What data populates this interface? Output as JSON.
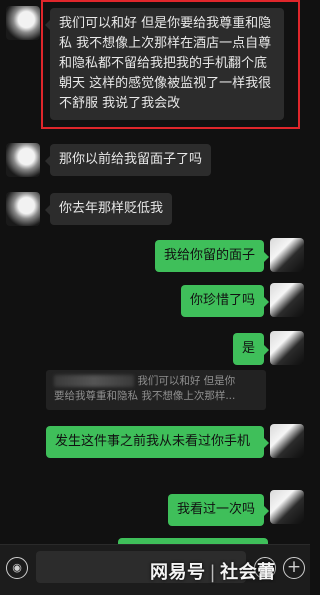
{
  "messages": [
    {
      "side": "them",
      "text": "我们可以和好 但是你要给我尊重和隐私 我不想像上次那样在酒店一点自尊和隐私都不留给我把我的手机翻个底朝天 这样的感觉像被监视了一样我很不舒服 我说了我会改"
    },
    {
      "side": "them",
      "text": "那你以前给我留面子了吗"
    },
    {
      "side": "them",
      "text": "你去年那样贬低我"
    },
    {
      "side": "me",
      "text": "我给你留的面子"
    },
    {
      "side": "me",
      "text": "你珍惜了吗"
    },
    {
      "side": "me",
      "text": "是"
    },
    {
      "side": "me",
      "text": "发生这件事之前我从未看过你手机"
    },
    {
      "side": "me",
      "text": "我看过一次吗"
    }
  ],
  "quote": {
    "line1": "我们可以和好 但是你",
    "line2": "要给我尊重和隐私 我不想像上次那样..."
  },
  "input": {
    "placeholder": ""
  },
  "watermark": {
    "brand": "网易号",
    "channel": "社会蕾"
  },
  "colors": {
    "accent": "#3fbf5a",
    "highlight": "#e0262b",
    "background": "#111111"
  },
  "icons": {
    "voice": "voice-icon",
    "emoji": "emoji-icon",
    "plus": "plus-icon"
  }
}
